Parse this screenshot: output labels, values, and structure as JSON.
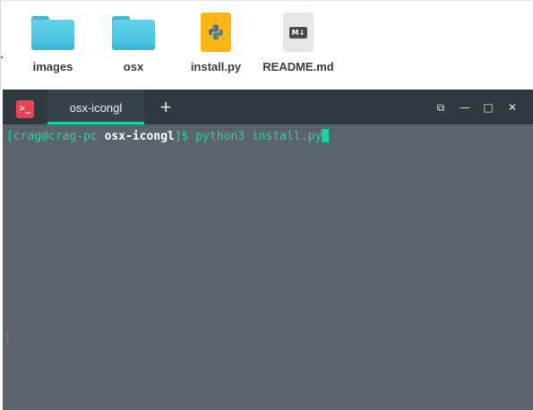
{
  "files": [
    {
      "name": "images",
      "type": "folder",
      "icon": "folder-icon"
    },
    {
      "name": "osx",
      "type": "folder",
      "icon": "folder-icon"
    },
    {
      "name": "install.py",
      "type": "python",
      "icon": "python-file-icon"
    },
    {
      "name": "README.md",
      "type": "markdown",
      "icon": "markdown-file-icon",
      "badge": "M↓"
    }
  ],
  "terminal": {
    "app_icon_glyph": ">_",
    "tab_label": "osx-icongl",
    "add_tab_glyph": "+",
    "controls": {
      "restore": "⧉",
      "minimize": "—",
      "maximize": "□",
      "close": "✕"
    },
    "prompt": {
      "open_bracket": "[",
      "user_host": "crag@crag-pc",
      "cwd": "osx-icongl",
      "close_dollar": "]$",
      "command": "python3 install.py"
    },
    "colors": {
      "accent": "#19d3a8",
      "titlebar": "#2f3a40",
      "body": "#5b646c",
      "app_icon": "#e64553"
    }
  }
}
